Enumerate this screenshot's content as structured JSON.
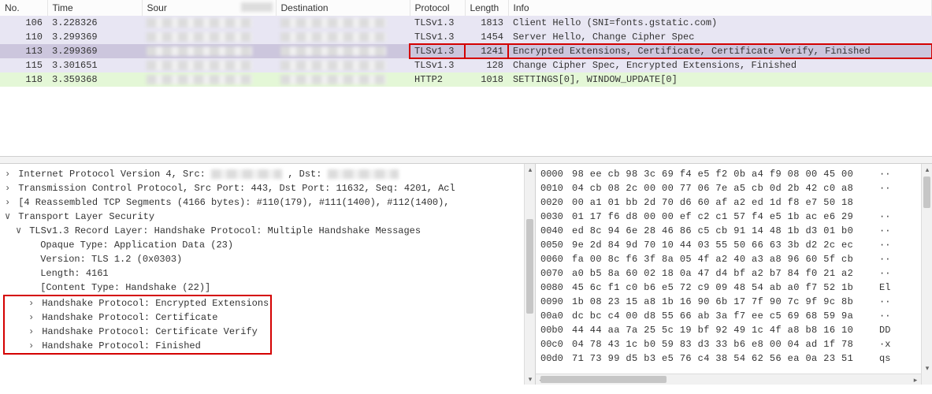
{
  "columns": {
    "no": "No.",
    "time": "Time",
    "source": "Sour",
    "destination": "Destination",
    "protocol": "Protocol",
    "length": "Length",
    "info": "Info"
  },
  "rows": [
    {
      "no": "106",
      "time": "3.228326",
      "protocol": "TLSv1.3",
      "length": "1813",
      "info": "Client Hello (SNI=fonts.gstatic.com)",
      "cls": "lavender"
    },
    {
      "no": "110",
      "time": "3.299369",
      "protocol": "TLSv1.3",
      "length": "1454",
      "info": "Server Hello, Change Cipher Spec",
      "cls": "lavender"
    },
    {
      "no": "113",
      "time": "3.299369",
      "protocol": "TLSv1.3",
      "length": "1241",
      "info": "Encrypted Extensions, Certificate, Certificate Verify, Finished",
      "cls": "selected",
      "red": true
    },
    {
      "no": "115",
      "time": "3.301651",
      "protocol": "TLSv1.3",
      "length": "128",
      "info": "Change Cipher Spec, Encrypted Extensions, Finished",
      "cls": "lavender"
    },
    {
      "no": "118",
      "time": "3.359368",
      "protocol": "HTTP2",
      "length": "1018",
      "info": "SETTINGS[0], WINDOW_UPDATE[0]",
      "cls": "green"
    }
  ],
  "tree": {
    "ipv4_prefix": "Internet Protocol Version 4, Src: ",
    "ipv4_mid": ", Dst: ",
    "tcp": "Transmission Control Protocol, Src Port: 443, Dst Port: 11632, Seq: 4201, Acl",
    "reasm": "[4 Reassembled TCP Segments (4166 bytes): #110(179), #111(1400), #112(1400),",
    "tls": "Transport Layer Security",
    "record": "TLSv1.3 Record Layer: Handshake Protocol: Multiple Handshake Messages",
    "otype": "Opaque Type: Application Data (23)",
    "version": "Version: TLS 1.2 (0x0303)",
    "length": "Length: 4161",
    "ctype": "[Content Type: Handshake (22)]",
    "hs1": "Handshake Protocol: Encrypted Extensions",
    "hs2": "Handshake Protocol: Certificate",
    "hs3": "Handshake Protocol: Certificate Verify",
    "hs4": "Handshake Protocol: Finished"
  },
  "hex": [
    {
      "off": "0000",
      "b": "98 ee cb 98 3c 69 f4 e5  f2 0b a4 f9 08 00 45 00",
      "a": "··"
    },
    {
      "off": "0010",
      "b": "04 cb 08 2c 00 00 77 06  7e a5 cb 0d 2b 42 c0 a8",
      "a": "··"
    },
    {
      "off": "0020",
      "b": "00 a1 01 bb 2d 70 d6 60  af a2 ed 1d f8 e7 50 18",
      "a": "  "
    },
    {
      "off": "0030",
      "b": "01 17 f6 d8 00 00 ef c2  c1 57 f4 e5 1b ac e6 29",
      "a": "··"
    },
    {
      "off": "0040",
      "b": "ed 8c 94 6e 28 46 86 c5  cb 91 14 48 1b d3 01 b0",
      "a": "··"
    },
    {
      "off": "0050",
      "b": "9e 2d 84 9d 70 10 44 03  55 50 66 63 3b d2 2c ec",
      "a": "··"
    },
    {
      "off": "0060",
      "b": "fa 00 8c f6 3f 8a 05 4f  a2 40 a3 a8 96 60 5f cb",
      "a": "··"
    },
    {
      "off": "0070",
      "b": "a0 b5 8a 60 02 18 0a 47  d4 bf a2 b7 84 f0 21 a2",
      "a": "··"
    },
    {
      "off": "0080",
      "b": "45 6c f1 c0 b6 e5 72 c9  09 48 54 ab a0 f7 52 1b",
      "a": "El"
    },
    {
      "off": "0090",
      "b": "1b 08 23 15 a8 1b 16 90  6b 17 7f 90 7c 9f 9c 8b",
      "a": "··"
    },
    {
      "off": "00a0",
      "b": "dc bc c4 00 d8 55 66 ab  3a f7 ee c5 69 68 59 9a",
      "a": "··"
    },
    {
      "off": "00b0",
      "b": "44 44 aa 7a 25 5c 19 bf  92 49 1c 4f a8 b8 16 10",
      "a": "DD"
    },
    {
      "off": "00c0",
      "b": "04 78 43 1c b0 59 83 d3  33 b6 e8 00 04 ad 1f 78",
      "a": "·x"
    },
    {
      "off": "00d0",
      "b": "71 73 99 d5 b3 e5 76 c4  38 54 62 56 ea 0a 23 51",
      "a": "qs"
    }
  ]
}
